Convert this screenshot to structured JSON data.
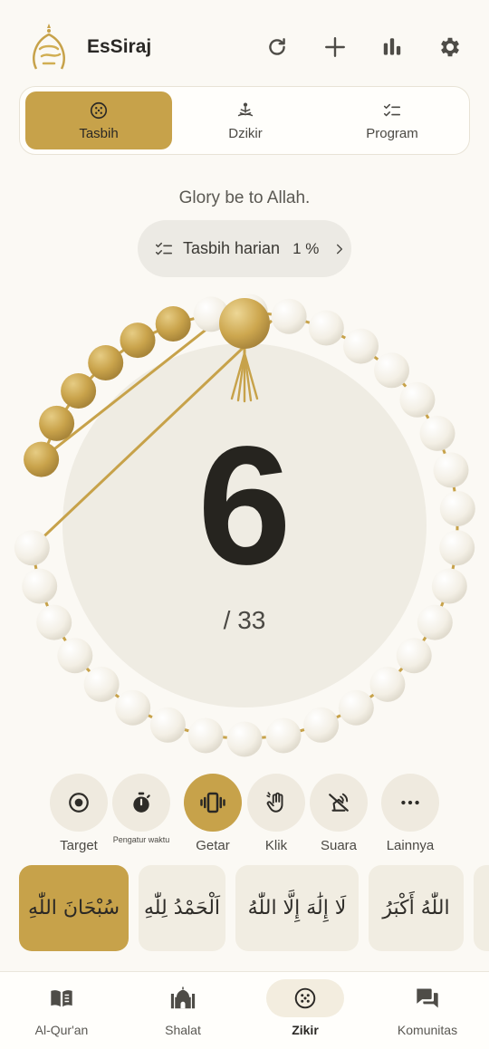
{
  "header": {
    "title": "EsSiraj",
    "logo_text": "سراج"
  },
  "modes": [
    {
      "label": "Tasbih",
      "active": true
    },
    {
      "label": "Dzikir",
      "active": false
    },
    {
      "label": "Program",
      "active": false
    }
  ],
  "main": {
    "subtitle": "Glory be to Allah.",
    "program": {
      "label": "Tasbih harian",
      "percent": "1 %"
    },
    "count": "6",
    "target": "/ 33",
    "count_value": 6,
    "target_value": 33
  },
  "controls": [
    {
      "label": "Target",
      "icon": "target-icon"
    },
    {
      "label": "Pengatur waktu",
      "icon": "stopwatch-icon"
    },
    {
      "label": "Getar",
      "icon": "vibrate-icon",
      "active": true
    },
    {
      "label": "Klik",
      "icon": "hand-icon"
    },
    {
      "label": "Suara",
      "icon": "sound-off-icon"
    },
    {
      "label": "Lainnya",
      "icon": "more-icon"
    }
  ],
  "dhikrs": [
    {
      "text": "سُبْحَانَ اللّٰهِ",
      "active": true
    },
    {
      "text": "اَلْحَمْدُ لِلّٰهِ"
    },
    {
      "text": "لَا إِلَٰهَ إِلَّا اللّٰهُ"
    },
    {
      "text": "اللّٰهُ أَكْبَرُ"
    }
  ],
  "nav": [
    {
      "label": "Al-Qur'an",
      "icon": "book-icon"
    },
    {
      "label": "Shalat",
      "icon": "mosque-icon"
    },
    {
      "label": "Zikir",
      "icon": "tasbih-icon",
      "active": true
    },
    {
      "label": "Komunitas",
      "icon": "chat-icon"
    }
  ],
  "colors": {
    "accent": "#c7a24a",
    "bead": "#f4f1e8",
    "bead_gold": "#c8a24a",
    "dial": "#efece3",
    "text": "#2a2825"
  }
}
